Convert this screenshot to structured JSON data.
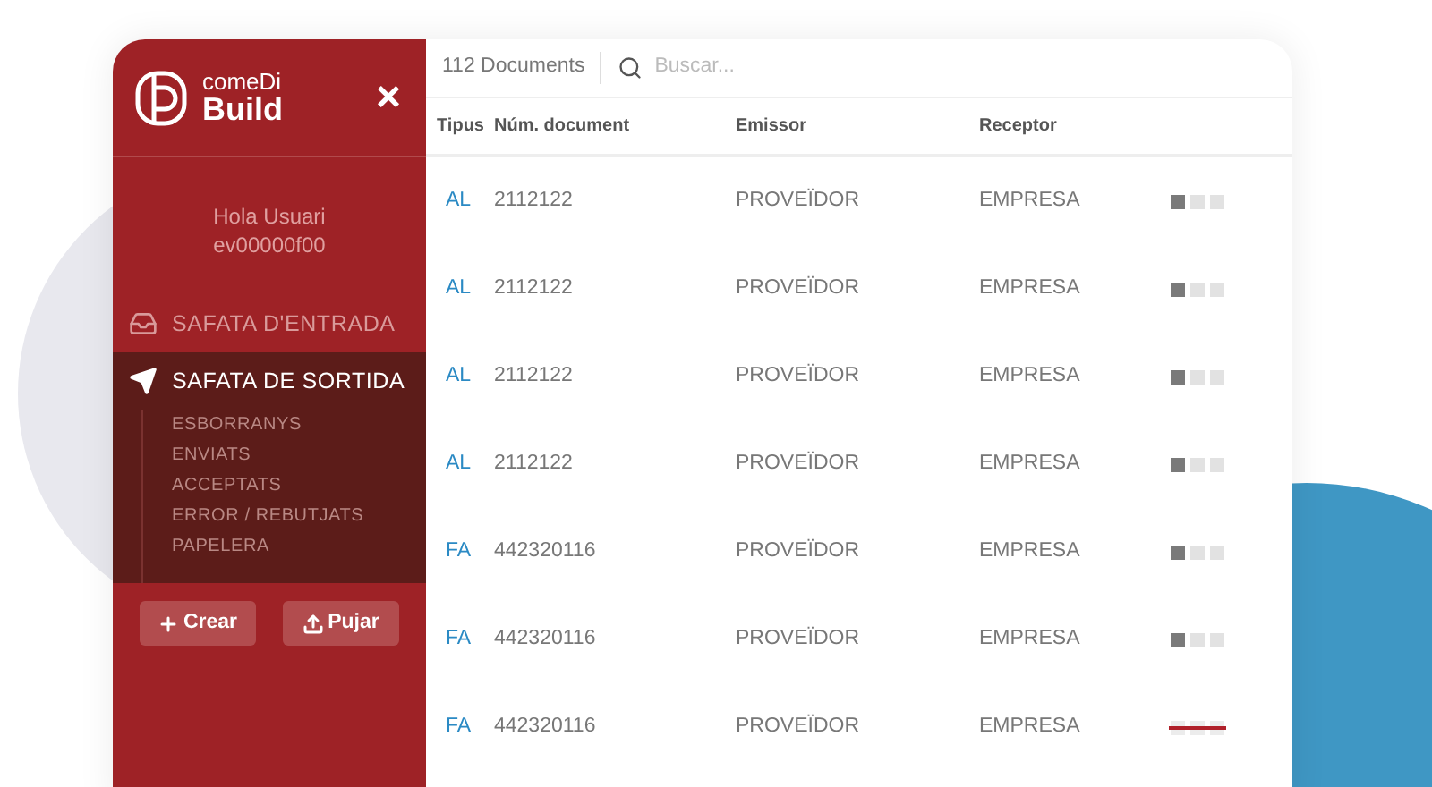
{
  "sidebar": {
    "logo": {
      "line1": "comeDi",
      "line2": "Build"
    },
    "close": "×",
    "greeting": "Hola Usuari",
    "user_id": "ev00000f00",
    "menu": [
      {
        "label": "SAFATA D'ENTRADA",
        "kind": "inbox",
        "selected": false
      },
      {
        "label": "SAFATA DE SORTIDA",
        "kind": "send",
        "selected": true,
        "children": [
          {
            "label": "ESBORRANYS"
          },
          {
            "label": "ENVIATS"
          },
          {
            "label": "ACCEPTATS"
          },
          {
            "label": "ERROR / REBUTJATS"
          },
          {
            "label": "PAPELERA"
          }
        ]
      }
    ],
    "buttons": [
      {
        "label": "Crear",
        "kind": "plus"
      },
      {
        "label": "Pujar",
        "kind": "upload"
      }
    ]
  },
  "toolbar": {
    "count": "112 Documents",
    "search": {
      "placeholder": "Buscar..."
    }
  },
  "table": {
    "columns": [
      "Tipus",
      "Núm. document",
      "Emissor",
      "Receptor"
    ],
    "rows": [
      {
        "type": "AL",
        "number": "2112122",
        "issuer": "PROVEÏDOR",
        "receiver": "EMPRESA",
        "kind": "pending"
      },
      {
        "type": "AL",
        "number": "2112122",
        "issuer": "PROVEÏDOR",
        "receiver": "EMPRESA",
        "kind": "pending"
      },
      {
        "type": "AL",
        "number": "2112122",
        "issuer": "PROVEÏDOR",
        "receiver": "EMPRESA",
        "kind": "pending"
      },
      {
        "type": "AL",
        "number": "2112122",
        "issuer": "PROVEÏDOR",
        "receiver": "EMPRESA",
        "kind": "pending"
      },
      {
        "type": "FA",
        "number": "442320116",
        "issuer": "PROVEÏDOR",
        "receiver": "EMPRESA",
        "kind": "pending"
      },
      {
        "type": "FA",
        "number": "442320116",
        "issuer": "PROVEÏDOR",
        "receiver": "EMPRESA",
        "kind": "pending"
      },
      {
        "type": "FA",
        "number": "442320116",
        "issuer": "PROVEÏDOR",
        "receiver": "EMPRESA",
        "kind": "rejected"
      }
    ]
  }
}
